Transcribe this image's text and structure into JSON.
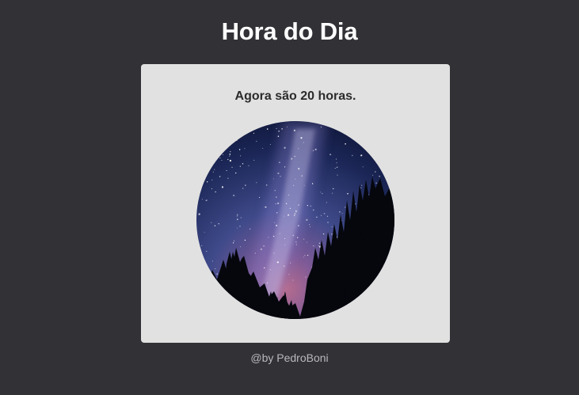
{
  "page": {
    "title": "Hora do Dia",
    "message": "Agora são 20 horas.",
    "footer": "@by PedroBoni"
  },
  "image": {
    "icon": "night-sky-forest-image"
  },
  "colors": {
    "background": "#313136",
    "card": "#e1e1e1",
    "title": "#ffffff",
    "message": "#2b2b2b",
    "footer": "#b9b9bd"
  }
}
